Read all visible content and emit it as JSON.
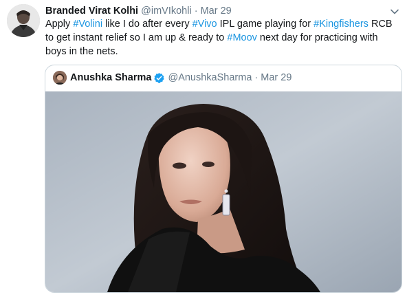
{
  "tweet": {
    "author_name": "Branded Virat Kolhi",
    "handle": "@imVIkohli",
    "separator": "·",
    "date": "Mar 29",
    "text_segments": [
      {
        "text": "Apply ",
        "hashtag": false
      },
      {
        "text": "#Volini",
        "hashtag": true
      },
      {
        "text": " like I do after every ",
        "hashtag": false
      },
      {
        "text": "#Vivo",
        "hashtag": true
      },
      {
        "text": " IPL game playing for ",
        "hashtag": false
      },
      {
        "text": "#Kingfishers",
        "hashtag": true
      },
      {
        "text": " RCB to get instant relief so I am up & ready to ",
        "hashtag": false
      },
      {
        "text": "#Moov",
        "hashtag": true
      },
      {
        "text": " next day for practicing with boys in the nets.",
        "hashtag": false
      }
    ]
  },
  "quoted_tweet": {
    "author_name": "Anushka Sharma",
    "handle": "@AnushkaSharma",
    "separator": "·",
    "date": "Mar 29",
    "verified": true
  },
  "icons": {
    "menu": "chevron-down-icon",
    "verified": "verified-badge-icon"
  },
  "colors": {
    "hashtag": "#1b95e0",
    "secondary_text": "#657786",
    "verified": "#1da1f2",
    "border": "#ccd6dd"
  }
}
